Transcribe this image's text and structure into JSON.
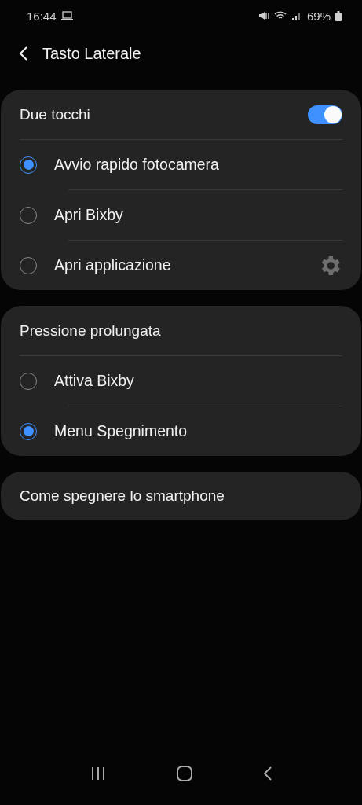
{
  "status_bar": {
    "time": "16:44",
    "battery": "69%"
  },
  "header": {
    "title": "Tasto Laterale"
  },
  "sections": [
    {
      "kind": "group",
      "title": "Due tocchi",
      "toggle": {
        "on": true
      },
      "options": [
        {
          "label": "Avvio rapido fotocamera",
          "selected": true,
          "settings_button": false
        },
        {
          "label": "Apri Bixby",
          "selected": false,
          "settings_button": false
        },
        {
          "label": "Apri applicazione",
          "selected": false,
          "settings_button": true
        }
      ]
    },
    {
      "kind": "group",
      "title": "Pressione prolungata",
      "options": [
        {
          "label": "Attiva Bixby",
          "selected": false,
          "settings_button": false
        },
        {
          "label": "Menu Spegnimento",
          "selected": true,
          "settings_button": false
        }
      ]
    },
    {
      "kind": "link",
      "title": "Come spegnere lo smartphone"
    }
  ]
}
